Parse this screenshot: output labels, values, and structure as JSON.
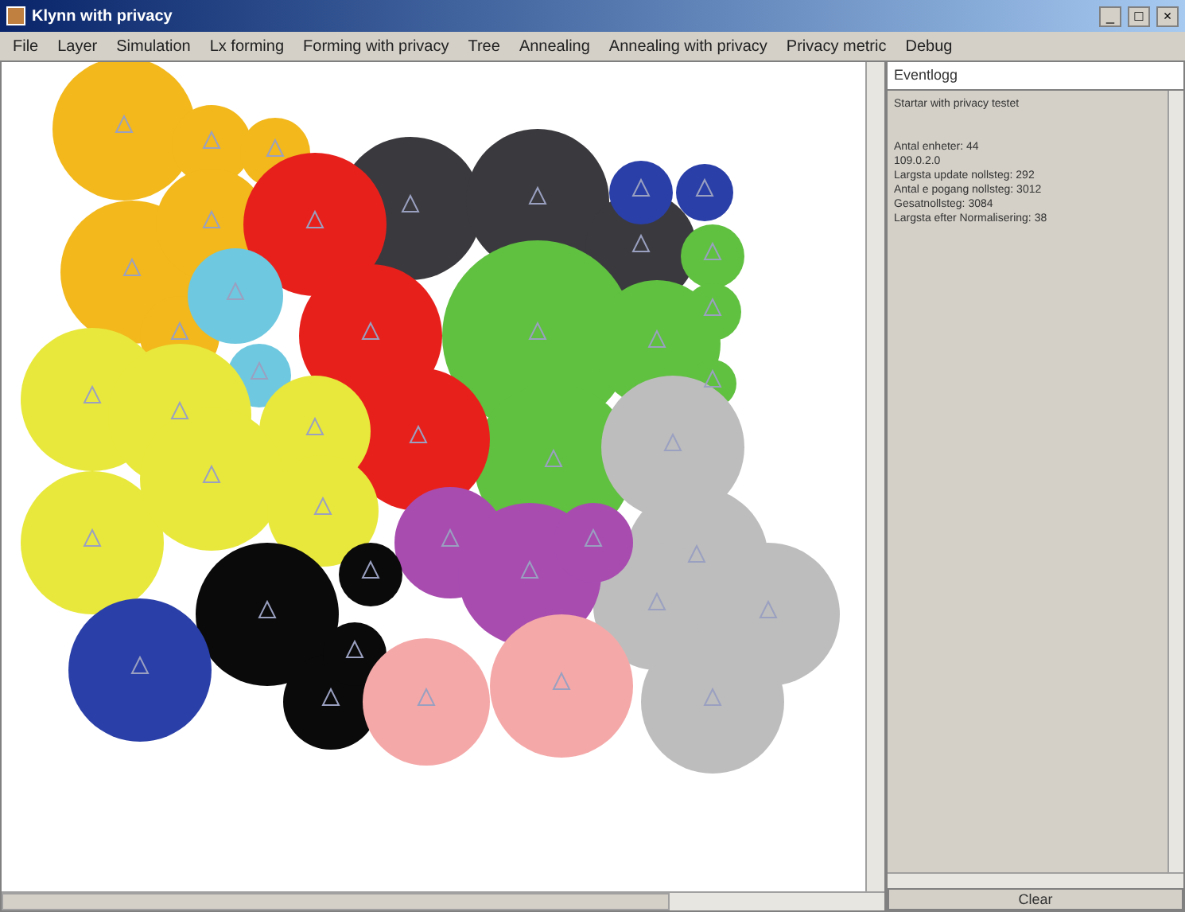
{
  "window": {
    "title": "Klynn with privacy",
    "controls": [
      "_",
      "□",
      "×"
    ]
  },
  "menu": [
    "File",
    "Layer",
    "Simulation",
    "Lx forming",
    "Forming with privacy",
    "Tree",
    "Annealing",
    "Annealing with privacy",
    "Privacy metric",
    "Debug"
  ],
  "log_panel": {
    "title": "Eventlogg",
    "heading": "Startar with privacy testet",
    "lines": [
      "Antal enheter: 44",
      "109.0.2.0",
      "Largsta update nollsteg: 292",
      "Antal e pogang nollsteg: 3012",
      "Gesatnollsteg: 3084",
      "Largsta efter Normalisering: 38"
    ],
    "button": "Clear"
  }
}
